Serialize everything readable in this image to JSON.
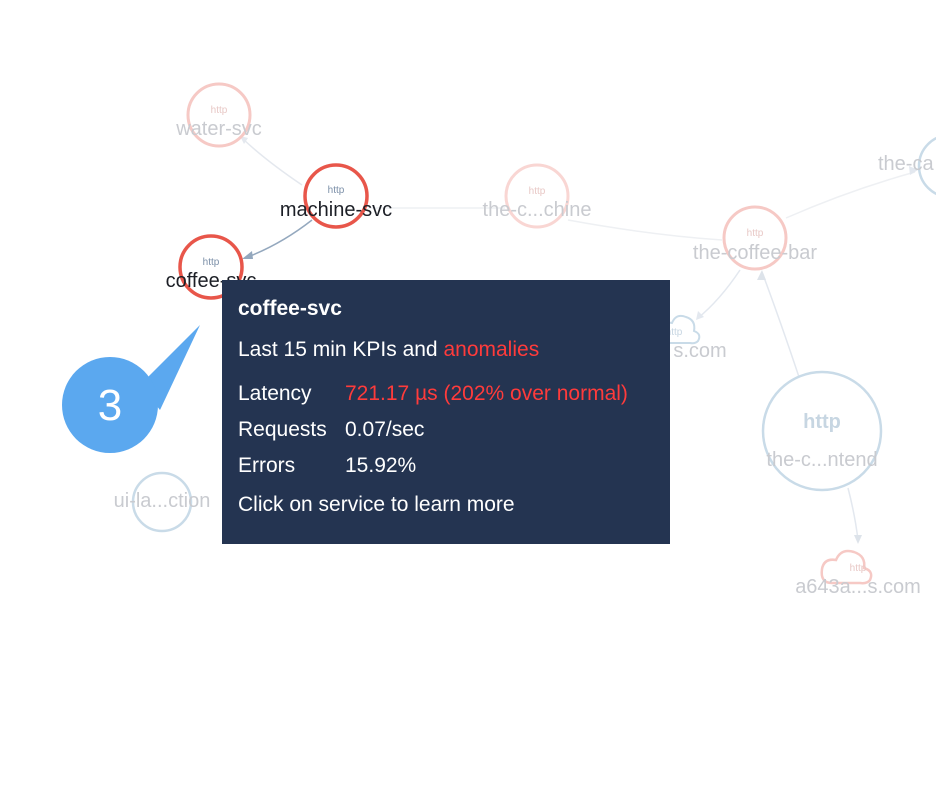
{
  "nodes": [
    {
      "name": "water-svc",
      "protocol": "http"
    },
    {
      "name": "machine-svc",
      "protocol": "http"
    },
    {
      "name": "the-c...chine",
      "protocol": "http"
    },
    {
      "name": "the-coffee-bar",
      "protocol": "http"
    },
    {
      "name": "the-ca",
      "protocol": ""
    },
    {
      "name": "coffee-svc",
      "protocol": "http"
    },
    {
      "name": "s.com",
      "protocol": "http"
    },
    {
      "name": "the-c...ntend",
      "protocol": "http"
    },
    {
      "name": "ui-la...ction",
      "protocol": ""
    },
    {
      "name": "a643a...s.com",
      "protocol": "http"
    }
  ],
  "tooltip": {
    "title": "coffee-svc",
    "subtitle_prefix": "Last 15 min KPIs and",
    "subtitle_highlight": "anomalies",
    "rows": [
      {
        "label": "Latency",
        "value": "721.17 µs (202% over normal)",
        "anomalous": true
      },
      {
        "label": "Requests",
        "value": "0.07/sec",
        "anomalous": false
      },
      {
        "label": "Errors",
        "value": "15.92%",
        "anomalous": false
      }
    ],
    "footer": "Click on service to learn more"
  },
  "callout": {
    "step": "3",
    "color": "#5ba8ef"
  },
  "colors": {
    "tooltip_bg": "#243451",
    "anomaly": "#ff3b3b",
    "node_red": "#e8564a",
    "node_faded_red": "#f6c9c5",
    "node_faded_blue": "#c9dbe8"
  }
}
